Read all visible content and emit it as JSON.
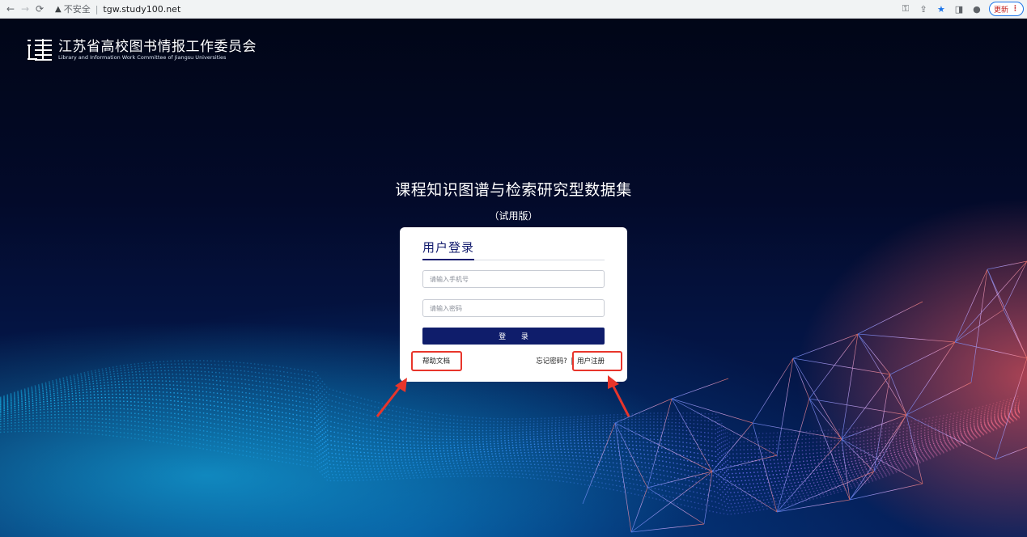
{
  "browser": {
    "security_label": "不安全",
    "url": "tgw.study100.net",
    "update_label": "更新"
  },
  "header": {
    "org_name_cn": "江苏省高校图书情报工作委员会",
    "org_name_en": "Library and Information Work Committee of Jiangsu Universities"
  },
  "main": {
    "title": "课程知识图谱与检索研究型数据集",
    "subtitle": "（试用版）"
  },
  "login": {
    "heading": "用户登录",
    "phone_placeholder": "请输入手机号",
    "password_placeholder": "请输入密码",
    "submit_label": "登 录",
    "help_label": "帮助文档",
    "forgot_label": "忘记密码?",
    "separator": "|",
    "register_label": "用户注册"
  },
  "colors": {
    "accent": "#0f1d6b",
    "annotation": "#e8352b"
  }
}
